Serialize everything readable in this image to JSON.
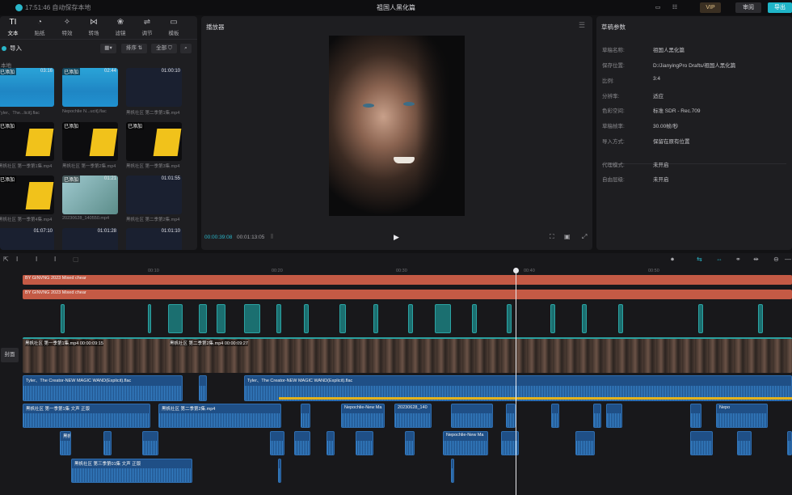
{
  "titlebar": {
    "save_status": "17:51:46 自动保存本地",
    "title": "祖国人黑化篇",
    "vip_label": "VIP",
    "review_label": "审阅",
    "export_label": "导出"
  },
  "media_panel": {
    "tools": [
      {
        "icon": "text-icon",
        "glyph": "TI",
        "label": "文本"
      },
      {
        "icon": "sticker-icon",
        "glyph": "◔",
        "label": "贴纸"
      },
      {
        "icon": "effects-icon",
        "glyph": "✧",
        "label": "特效"
      },
      {
        "icon": "transition-icon",
        "glyph": "⋈",
        "label": "转场"
      },
      {
        "icon": "filter-icon",
        "glyph": "❀",
        "label": "滤镜"
      },
      {
        "icon": "adjust-icon",
        "glyph": "⇌",
        "label": "调节"
      },
      {
        "icon": "template-icon",
        "glyph": "▭",
        "label": "模板"
      }
    ],
    "import_label": "导入",
    "sort_label": "排序",
    "filter_all_label": "全部",
    "local_label": "本地",
    "items": [
      {
        "tag": "已添加",
        "duration": "03:16",
        "name": "Tyler、The...licit].flac",
        "type": "audio"
      },
      {
        "tag": "已添加",
        "duration": "02:44",
        "name": "Nepochlie N...ucit].flac",
        "type": "audio"
      },
      {
        "tag": "",
        "duration": "01:00:10",
        "name": "黑帆社区 第二季第1集.mp4",
        "type": "dark"
      },
      {
        "tag": "已添加",
        "duration": "",
        "name": "黑帆社区 第一季第1集.mp4",
        "type": "yellow"
      },
      {
        "tag": "已添加",
        "duration": "",
        "name": "黑帆社区 第一季第2集.mp4",
        "type": "yellow"
      },
      {
        "tag": "已添加",
        "duration": "",
        "name": "黑帆社区 第一季第3集.mp4",
        "type": "yellow"
      },
      {
        "tag": "已添加",
        "duration": "",
        "name": "黑帆社区 第一季第4集.mp4",
        "type": "yellow"
      },
      {
        "tag": "已添加",
        "duration": "01:21",
        "name": "20230628_140550.mp4",
        "type": "photo"
      },
      {
        "tag": "",
        "duration": "01:01:55",
        "name": "黑帆社区 第二季第2集.mp4",
        "type": "dark"
      },
      {
        "tag": "",
        "duration": "01:07:10",
        "name": "",
        "type": "dark"
      },
      {
        "tag": "",
        "duration": "01:01:28",
        "name": "",
        "type": "dark"
      },
      {
        "tag": "",
        "duration": "01:01:10",
        "name": "",
        "type": "dark"
      }
    ]
  },
  "player": {
    "title": "播放器",
    "current_time": "00:00:39:08",
    "total_time": "00:01:13:05"
  },
  "properties": {
    "title": "草稿参数",
    "rows": [
      {
        "key": "草稿名称:",
        "value": "祖国人黑化篇"
      },
      {
        "key": "保存位置:",
        "value": "D:/JianyingPro Drafts/祖国人黑化篇"
      },
      {
        "key": "比例:",
        "value": "3:4"
      },
      {
        "key": "分辨率:",
        "value": "适应"
      },
      {
        "key": "色彩空间:",
        "value": "标准 SDR - Rec.709"
      },
      {
        "key": "草稿帧率:",
        "value": "30.00帧/秒"
      },
      {
        "key": "导入方式:",
        "value": "保留在原有位置"
      }
    ],
    "rows2": [
      {
        "key": "代理模式:",
        "value": "未开启"
      },
      {
        "key": "自由层级:",
        "value": "未开启"
      }
    ]
  },
  "timeline": {
    "ruler_ticks": [
      "00:10",
      "00:20",
      "00:30",
      "00:40",
      "00:50"
    ],
    "music_clip_1": "BY GINVNG 2023 Mixed chear",
    "music_clip_2": "BY GINVNG 2023 Mixed chear",
    "video_clip_1": "黑帆社区 第一季第1集.mp4  00:00:09:15",
    "video_clip_2": "黑帆社区 第二季第2集.mp4  00:00:09:27",
    "cover_label": "封面",
    "audio_main_1": "Tyler、The Creator-NEW MAGIC WAND(Explicit).flac",
    "audio_main_2": "Tyler、The Creator-NEW MAGIC WAND(Explicit).flac",
    "audio_row3_1": "黑帆社区 第一季第1集  文声 正版",
    "audio_row3_2": "黑帆社区 第二季第2集.mp4",
    "audio_row3_3": "Nepochlie-New Ma",
    "audio_row3_4": "20230628_140",
    "audio_row3_5": "Nepo",
    "audio_row4_1": "黑帆",
    "audio_row4_2": "Nepochlie-New Ma",
    "audio_row5_1": "黑帆社区 第三季第01集  文声 正版"
  }
}
